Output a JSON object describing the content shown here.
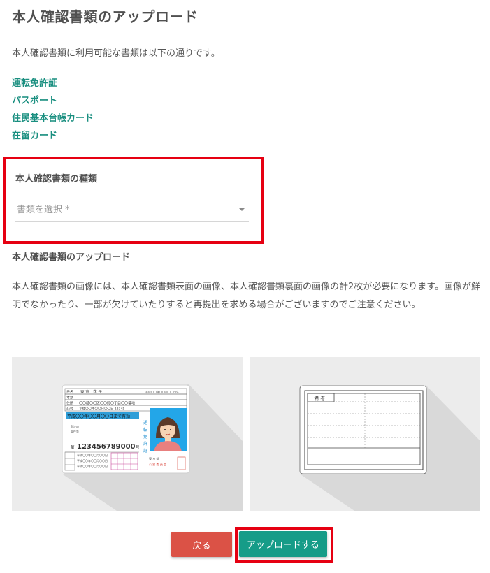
{
  "page": {
    "title": "本人確認書類のアップロード",
    "intro": "本人確認書類に利用可能な書類は以下の通りです。"
  },
  "documents": [
    {
      "label": "運転免許証"
    },
    {
      "label": "パスポート"
    },
    {
      "label": "住民基本台帳カード"
    },
    {
      "label": "在留カード"
    }
  ],
  "type_select": {
    "label": "本人確認書類の種類",
    "placeholder": "書類を選択 *"
  },
  "upload": {
    "heading": "本人確認書類のアップロード",
    "description": "本人確認書類の画像には、本人確認書類表面の画像、本人確認書類裏面の画像の計2枚が必要になります。画像が鮮明でなかったり、一部が欠けていたりすると再提出を求める場合がございますのでご注意ください。"
  },
  "license_front": {
    "name_label": "氏名",
    "name": "東 京　花 子",
    "birth": "平成〇〇年〇〇月〇〇日生",
    "honseki_label": "本籍",
    "address_label": "住所",
    "address": "〇〇都〇〇区〇〇町〇丁目〇〇番地",
    "issue_label": "交付",
    "issue": "平成〇〇年〇〇月〇〇日 12345",
    "validity": "平成〇〇年〇〇月〇〇日まで有効",
    "vertical_text": "運転免許証",
    "number_label": "第",
    "number": "123456789000",
    "number_suffix": "号",
    "koan": "東京都公安委員会"
  },
  "license_back": {
    "remarks_label": "備 考"
  },
  "buttons": {
    "back": "戻る",
    "upload": "アップロードする"
  },
  "colors": {
    "accent": "#169c88",
    "link": "#1a8f80",
    "back_button": "#db5246",
    "highlight": "#e60012"
  }
}
